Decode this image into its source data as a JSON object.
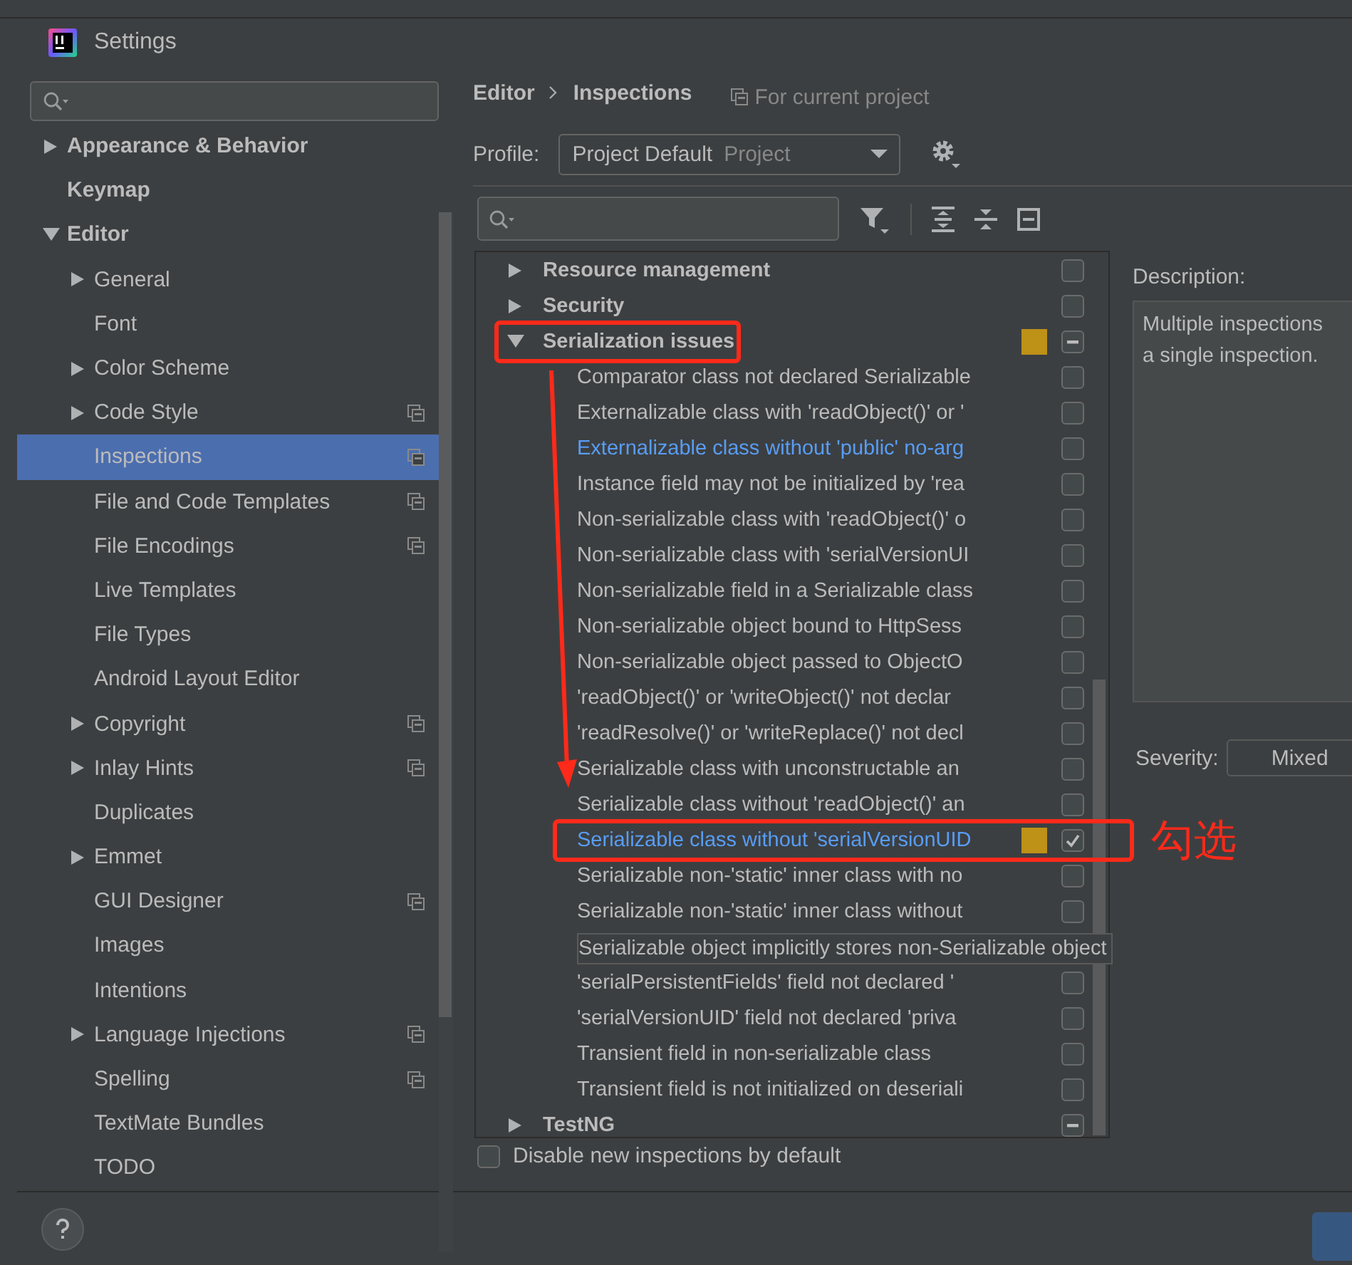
{
  "window": {
    "title": "Settings"
  },
  "sidebar": {
    "items": [
      {
        "label": "Appearance & Behavior",
        "bold": true,
        "expandable": true,
        "expanded": false,
        "selected": false,
        "project_scope": false
      },
      {
        "label": "Keymap",
        "bold": true,
        "expandable": false,
        "selected": false,
        "project_scope": false
      },
      {
        "label": "Editor",
        "bold": true,
        "expandable": true,
        "expanded": true,
        "selected": false,
        "project_scope": false,
        "children": [
          {
            "label": "General",
            "expandable": true,
            "expanded": false,
            "selected": false,
            "project_scope": false
          },
          {
            "label": "Font",
            "expandable": false,
            "selected": false,
            "project_scope": false
          },
          {
            "label": "Color Scheme",
            "expandable": true,
            "expanded": false,
            "selected": false,
            "project_scope": false
          },
          {
            "label": "Code Style",
            "expandable": true,
            "expanded": false,
            "selected": false,
            "project_scope": true
          },
          {
            "label": "Inspections",
            "expandable": false,
            "selected": true,
            "project_scope": true
          },
          {
            "label": "File and Code Templates",
            "expandable": false,
            "selected": false,
            "project_scope": true
          },
          {
            "label": "File Encodings",
            "expandable": false,
            "selected": false,
            "project_scope": true
          },
          {
            "label": "Live Templates",
            "expandable": false,
            "selected": false,
            "project_scope": false
          },
          {
            "label": "File Types",
            "expandable": false,
            "selected": false,
            "project_scope": false
          },
          {
            "label": "Android Layout Editor",
            "expandable": false,
            "selected": false,
            "project_scope": false
          },
          {
            "label": "Copyright",
            "expandable": true,
            "expanded": false,
            "selected": false,
            "project_scope": true
          },
          {
            "label": "Inlay Hints",
            "expandable": true,
            "expanded": false,
            "selected": false,
            "project_scope": true
          },
          {
            "label": "Duplicates",
            "expandable": false,
            "selected": false,
            "project_scope": false
          },
          {
            "label": "Emmet",
            "expandable": true,
            "expanded": false,
            "selected": false,
            "project_scope": false
          },
          {
            "label": "GUI Designer",
            "expandable": false,
            "selected": false,
            "project_scope": true
          },
          {
            "label": "Images",
            "expandable": false,
            "selected": false,
            "project_scope": false
          },
          {
            "label": "Intentions",
            "expandable": false,
            "selected": false,
            "project_scope": false
          },
          {
            "label": "Language Injections",
            "expandable": true,
            "expanded": false,
            "selected": false,
            "project_scope": true
          },
          {
            "label": "Spelling",
            "expandable": false,
            "selected": false,
            "project_scope": true
          },
          {
            "label": "TextMate Bundles",
            "expandable": false,
            "selected": false,
            "project_scope": false
          },
          {
            "label": "TODO",
            "expandable": false,
            "selected": false,
            "project_scope": false
          }
        ]
      }
    ]
  },
  "breadcrumb": [
    "Editor",
    "Inspections"
  ],
  "scope_note": "For current project",
  "profile": {
    "label": "Profile:",
    "value": "Project Default",
    "scope": "Project"
  },
  "inspections": {
    "groups": [
      {
        "label": "Resource management",
        "expanded": false,
        "checked": false,
        "mixed": false,
        "marker": false
      },
      {
        "label": "Security",
        "expanded": false,
        "checked": false,
        "mixed": false,
        "marker": false
      },
      {
        "label": "Serialization issues",
        "expanded": true,
        "mixed": true,
        "marker": true,
        "annotated": true,
        "children": [
          {
            "label": "Comparator class not declared Serializable",
            "modified": false,
            "checked": false,
            "marker": false
          },
          {
            "label": "Externalizable class with 'readObject()' or '",
            "modified": false,
            "checked": false,
            "marker": false
          },
          {
            "label": "Externalizable class without 'public' no-arg",
            "modified": true,
            "checked": false,
            "marker": false
          },
          {
            "label": "Instance field may not be initialized by 'rea",
            "modified": false,
            "checked": false,
            "marker": false
          },
          {
            "label": "Non-serializable class with 'readObject()' o",
            "modified": false,
            "checked": false,
            "marker": false
          },
          {
            "label": "Non-serializable class with 'serialVersionUI",
            "modified": false,
            "checked": false,
            "marker": false
          },
          {
            "label": "Non-serializable field in a Serializable class",
            "modified": false,
            "checked": false,
            "marker": false
          },
          {
            "label": "Non-serializable object bound to HttpSess",
            "modified": false,
            "checked": false,
            "marker": false
          },
          {
            "label": "Non-serializable object passed to ObjectO",
            "modified": false,
            "checked": false,
            "marker": false
          },
          {
            "label": "'readObject()' or 'writeObject()' not declar",
            "modified": false,
            "checked": false,
            "marker": false
          },
          {
            "label": "'readResolve()' or 'writeReplace()' not decl",
            "modified": false,
            "checked": false,
            "marker": false
          },
          {
            "label": "Serializable class with unconstructable an",
            "modified": false,
            "checked": false,
            "marker": false
          },
          {
            "label": "Serializable class without 'readObject()' an",
            "modified": false,
            "checked": false,
            "marker": false
          },
          {
            "label": "Serializable class without 'serialVersionUID",
            "modified": true,
            "checked": true,
            "marker": true,
            "annotated": true
          },
          {
            "label": "Serializable non-'static' inner class with no",
            "modified": false,
            "checked": false,
            "marker": false
          },
          {
            "label": "Serializable non-'static' inner class without",
            "modified": false,
            "checked": false,
            "marker": false
          },
          {
            "label": "Serializable object implicitly stores non-Serializable object",
            "modified": false,
            "tooltip": true
          },
          {
            "label": "'serialPersistentFields' field not declared '",
            "modified": false,
            "checked": false,
            "marker": false
          },
          {
            "label": "'serialVersionUID' field not declared 'priva",
            "modified": false,
            "checked": false,
            "marker": false
          },
          {
            "label": "Transient field in non-serializable class",
            "modified": false,
            "checked": false,
            "marker": false
          },
          {
            "label": "Transient field is not initialized on deseriali",
            "modified": false,
            "checked": false,
            "marker": false
          }
        ]
      },
      {
        "label": "TestNG",
        "expanded": false,
        "mixed": true,
        "marker": false
      }
    ]
  },
  "description": {
    "label": "Description:",
    "lines": [
      "Multiple inspections",
      "a single inspection."
    ]
  },
  "severity": {
    "label": "Severity:",
    "value": "Mixed"
  },
  "disable_new": {
    "label": "Disable new inspections by default",
    "checked": false
  },
  "annotation": {
    "label": "勾选"
  }
}
